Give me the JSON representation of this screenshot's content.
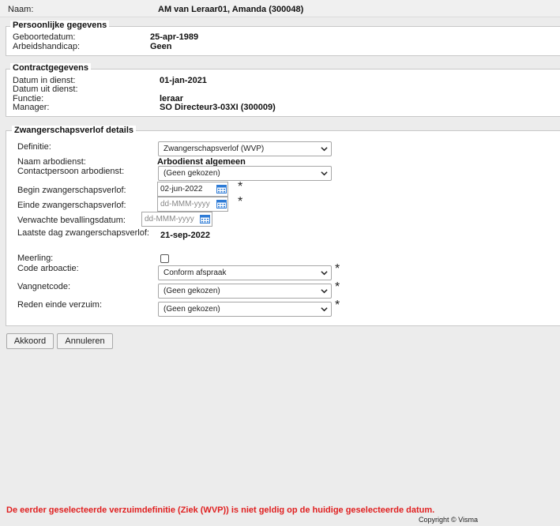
{
  "header": {
    "name_label": "Naam:",
    "name_value": "AM van Leraar01, Amanda (300048)"
  },
  "personal": {
    "legend": "Persoonlijke gegevens",
    "birth_label": "Geboortedatum:",
    "birth_value": "25-apr-1989",
    "handicap_label": "Arbeidshandicap:",
    "handicap_value": "Geen"
  },
  "contract": {
    "legend": "Contractgegevens",
    "start_label": "Datum in dienst:",
    "start_value": "01-jan-2021",
    "end_label": "Datum uit dienst:",
    "function_label": "Functie:",
    "function_value": "leraar",
    "manager_label": "Manager:",
    "manager_value": "SO Directeur3-03XI (300009)"
  },
  "leave": {
    "legend": "Zwangerschapsverlof details",
    "definition_label": "Definitie:",
    "definition_value": "Zwangerschapsverlof (WVP)",
    "arbodienst_label": "Naam arbodienst:",
    "arbodienst_value": "Arbodienst algemeen",
    "contact_label": "Contactpersoon arbodienst:",
    "contact_value": "(Geen gekozen)",
    "begin_label": "Begin zwangerschapsverlof:",
    "begin_value": "02-jun-2022",
    "einde_label": "Einde zwangerschapsverlof:",
    "einde_placeholder": "dd-MMM-yyyy",
    "expected_label": "Verwachte bevallingsdatum:",
    "expected_placeholder": "dd-MMM-yyyy",
    "lastday_label": "Laatste dag zwangerschapsverlof:",
    "lastday_value": "21-sep-2022",
    "meerling_label": "Meerling:",
    "code_label": "Code arboactie:",
    "code_value": "Conform afspraak",
    "vangnet_label": "Vangnetcode:",
    "vangnet_value": "(Geen gekozen)",
    "reden_label": "Reden einde verzuim:",
    "reden_value": "(Geen gekozen)",
    "required_mark": "*"
  },
  "buttons": {
    "ok": "Akkoord",
    "cancel": "Annuleren"
  },
  "error_message": "De eerder geselecteerde verzuimdefinitie (Ziek (WVP)) is niet geldig op de huidige geselecteerde datum.",
  "footer": {
    "copyright": "Copyright © Visma"
  },
  "colors": {
    "background": "#ececec",
    "panel": "#ffffff",
    "error": "#e02020",
    "calendar_icon": "#2e7bd6"
  }
}
